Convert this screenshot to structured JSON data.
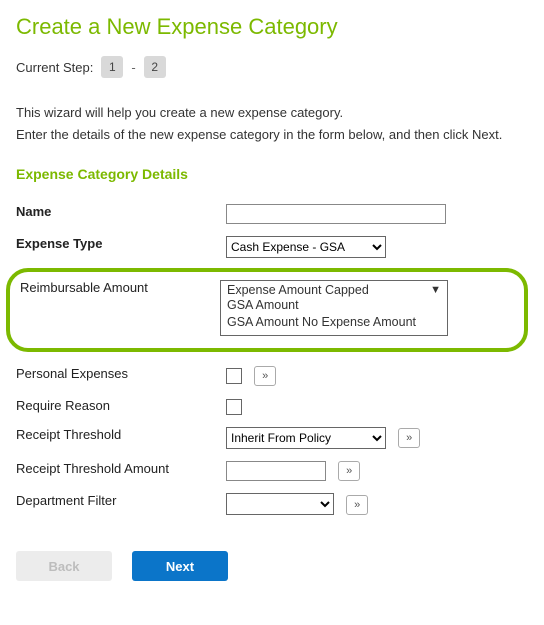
{
  "title": "Create a New Expense Category",
  "steps": {
    "label": "Current Step:",
    "step1": "1",
    "sep": "- ",
    "step2": "2"
  },
  "intro": {
    "line1": "This wizard will help you create a new expense category.",
    "line2": "Enter the details of the new expense category in the form below, and then click Next."
  },
  "section_title": "Expense Category Details",
  "fields": {
    "name_label": "Name",
    "name_value": "",
    "expense_type_label": "Expense Type",
    "expense_type_value": "Cash Expense - GSA",
    "reimbursable_label": "Reimbursable Amount",
    "reimbursable_selected": "Expense Amount Capped",
    "reimbursable_options": [
      "Expense Amount Capped",
      "GSA Amount",
      "GSA Amount No Expense Amount"
    ],
    "personal_exp_label": "Personal Expenses",
    "require_reason_label": "Require Reason",
    "receipt_threshold_label": "Receipt Threshold",
    "receipt_threshold_value": "Inherit From Policy",
    "receipt_threshold_amount_label": "Receipt Threshold Amount",
    "receipt_threshold_amount_value": "",
    "department_filter_label": "Department Filter",
    "department_filter_value": ""
  },
  "buttons": {
    "back": "Back",
    "next": "Next"
  },
  "glyphs": {
    "more": "»"
  }
}
